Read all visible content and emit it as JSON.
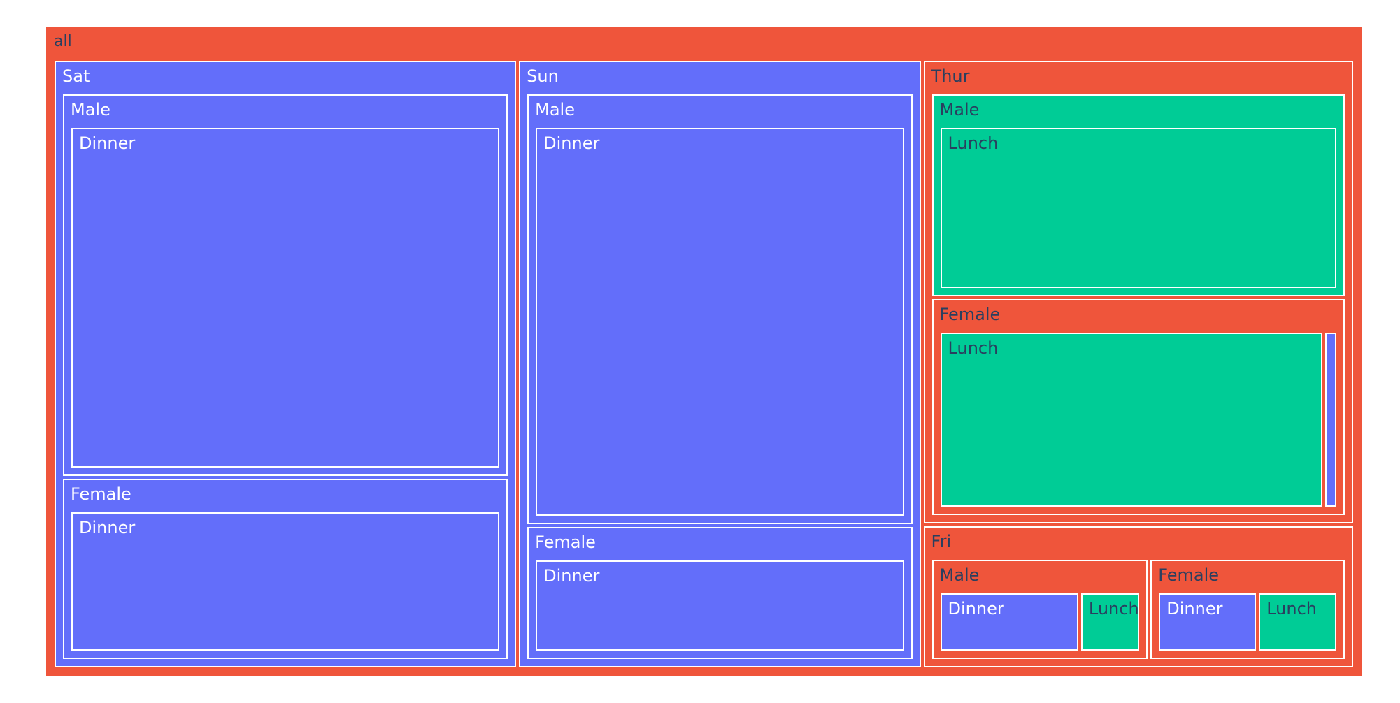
{
  "chart_data": {
    "type": "treemap",
    "colors": {
      "root": "#EF553B",
      "Dinner": "#636EFA",
      "Lunch": "#00CC96",
      "dark_text": "#2a3f5f",
      "light_text": "#ffffff"
    },
    "root": {
      "label": "all",
      "children": [
        {
          "label": "Sat",
          "children": [
            {
              "label": "Male",
              "children": [
                {
                  "label": "Dinner",
                  "value": 59
                }
              ]
            },
            {
              "label": "Female",
              "children": [
                {
                  "label": "Dinner",
                  "value": 28
                }
              ]
            }
          ]
        },
        {
          "label": "Sun",
          "children": [
            {
              "label": "Male",
              "children": [
                {
                  "label": "Dinner",
                  "value": 58
                }
              ]
            },
            {
              "label": "Female",
              "children": [
                {
                  "label": "Dinner",
                  "value": 18
                }
              ]
            }
          ]
        },
        {
          "label": "Thur",
          "children": [
            {
              "label": "Male",
              "children": [
                {
                  "label": "Lunch",
                  "value": 30
                }
              ]
            },
            {
              "label": "Female",
              "children": [
                {
                  "label": "Lunch",
                  "value": 31
                },
                {
                  "label": "Dinner",
                  "value": 1
                }
              ]
            }
          ]
        },
        {
          "label": "Fri",
          "children": [
            {
              "label": "Male",
              "children": [
                {
                  "label": "Dinner",
                  "value": 7
                },
                {
                  "label": "Lunch",
                  "value": 3
                }
              ]
            },
            {
              "label": "Female",
              "children": [
                {
                  "label": "Dinner",
                  "value": 5
                },
                {
                  "label": "Lunch",
                  "value": 4
                }
              ]
            }
          ]
        }
      ]
    }
  }
}
